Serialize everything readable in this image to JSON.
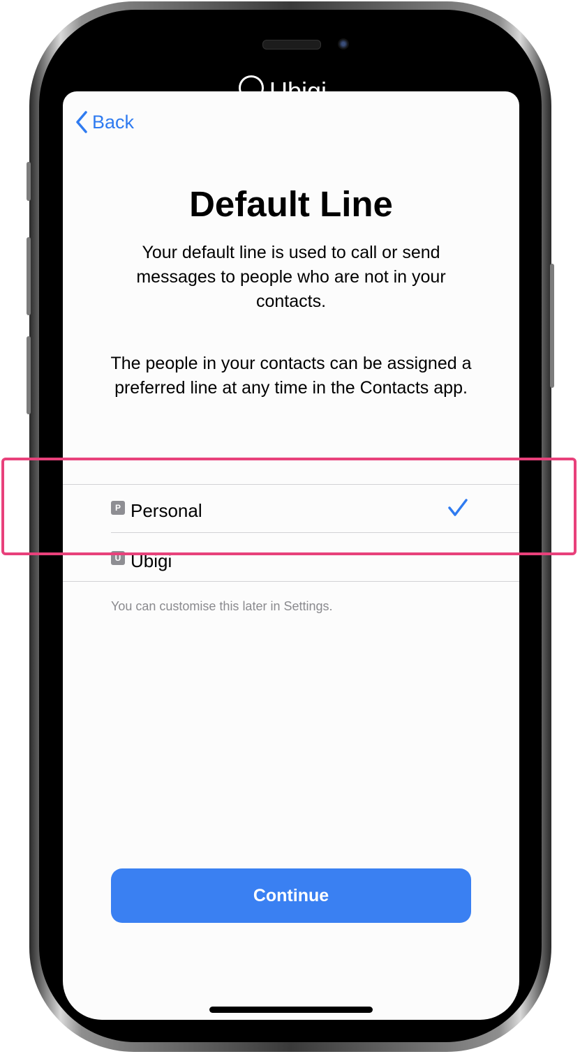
{
  "background_app": {
    "logo_text": "Ubigi"
  },
  "nav": {
    "back_label": "Back"
  },
  "title": "Default Line",
  "description_1": "Your default line is used to call or send messages to people who are not in your contacts.",
  "description_2": "The people in your contacts can be assigned a preferred line at any time in the Contacts app.",
  "lines": [
    {
      "badge": "P",
      "label": "Personal",
      "selected": true
    },
    {
      "badge": "U",
      "label": "Ubigi",
      "selected": false
    }
  ],
  "note": "You can customise this later in Settings.",
  "continue_label": "Continue",
  "colors": {
    "accent": "#3a80f2",
    "highlight": "#e8417b",
    "badge": "#8e8e93"
  }
}
